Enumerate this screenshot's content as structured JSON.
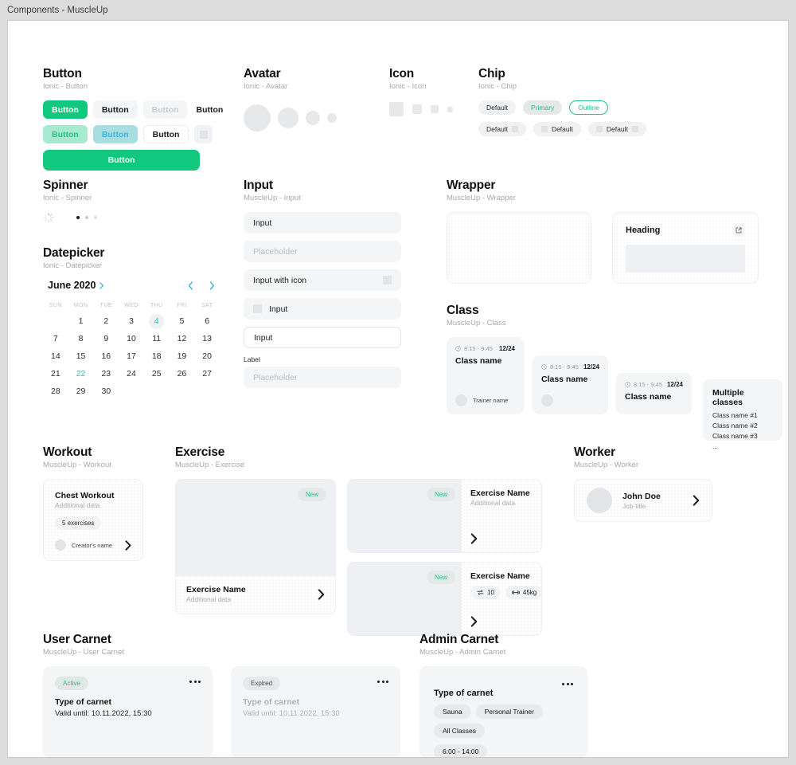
{
  "window": {
    "title": "Components - MuscleUp"
  },
  "colors": {
    "primary_green": "#10c97e",
    "teal_accent": "#24c28a",
    "blue_accent": "#3fb6d8",
    "surface": "#f4f5f7",
    "muted_text": "#a6a8ab"
  },
  "sections": {
    "button": {
      "title": "Button",
      "subtitle": "Ionic - Button"
    },
    "spinner": {
      "title": "Spinner",
      "subtitle": "Ionic - Spinner"
    },
    "datepicker": {
      "title": "Datepicker",
      "subtitle": "Ionic - Datepicker"
    },
    "avatar": {
      "title": "Avatar",
      "subtitle": "Ionic - Avatar"
    },
    "icon": {
      "title": "Icon",
      "subtitle": "Ionic - Icon"
    },
    "chip": {
      "title": "Chip",
      "subtitle": "Ionic - Chip"
    },
    "input": {
      "title": "Input",
      "subtitle": "MuscleUp - Input"
    },
    "wrapper": {
      "title": "Wrapper",
      "subtitle": "MuscleUp - Wrapper"
    },
    "class": {
      "title": "Class",
      "subtitle": "MuscleUp - Class"
    },
    "workout": {
      "title": "Workout",
      "subtitle": "MuscleUp - Workout"
    },
    "exercise": {
      "title": "Exercise",
      "subtitle": "MuscleUp - Exercise"
    },
    "worker": {
      "title": "Worker",
      "subtitle": "MuscleUp - Worker"
    },
    "user_carnet": {
      "title": "User Carnet",
      "subtitle": "MuscleUp - User Carnet"
    },
    "admin_carnet": {
      "title": "Admin Carnet",
      "subtitle": "MuscleUp - Admin Carnet"
    }
  },
  "buttons": {
    "row1": [
      {
        "label": "Button",
        "variant": "solid"
      },
      {
        "label": "Button",
        "variant": "light"
      },
      {
        "label": "Button",
        "variant": "disabled"
      },
      {
        "label": "Button",
        "variant": "plain"
      }
    ],
    "row2": [
      {
        "label": "Button",
        "variant": "teal-soft"
      },
      {
        "label": "Button",
        "variant": "teal-soft2"
      },
      {
        "label": "Button",
        "variant": "outline"
      },
      {
        "label": "",
        "variant": "icon-only"
      }
    ],
    "full": {
      "label": "Button",
      "variant": "solid-full"
    }
  },
  "spinner": {
    "dots": [
      {
        "color": "#1b1b1b"
      },
      {
        "color": "#c7cace"
      },
      {
        "color": "#dde0e3"
      }
    ]
  },
  "datepicker": {
    "month_label": "June 2020",
    "dow": [
      "SUN",
      "MON",
      "TUE",
      "WED",
      "THU",
      "FRI",
      "SAT"
    ],
    "leading_blanks": 1,
    "days": [
      1,
      2,
      3,
      4,
      5,
      6,
      7,
      8,
      9,
      10,
      11,
      12,
      13,
      14,
      15,
      16,
      17,
      18,
      19,
      20,
      21,
      22,
      23,
      24,
      25,
      26,
      27,
      28,
      29,
      30
    ],
    "selected_day": 4,
    "highlighted_day": 22
  },
  "avatar": {
    "sizes": [
      34,
      26,
      18,
      12
    ]
  },
  "icon": {
    "sizes": [
      18,
      12,
      10,
      7
    ]
  },
  "chips": {
    "row1": [
      {
        "label": "Default",
        "variant": "default"
      },
      {
        "label": "Primary",
        "variant": "primary"
      },
      {
        "label": "Outline",
        "variant": "outline"
      }
    ],
    "row2": [
      {
        "label": "Default",
        "icon": "trailing"
      },
      {
        "label": "Default",
        "icon": "leading"
      },
      {
        "label": "Default",
        "icon": "both"
      }
    ]
  },
  "inputs": [
    {
      "value": "Input",
      "style": "filled",
      "icon": "none"
    },
    {
      "value": "Placeholder",
      "style": "filled-ph",
      "icon": "none"
    },
    {
      "value": "Input with icon",
      "style": "filled",
      "icon": "trailing"
    },
    {
      "value": "Input",
      "style": "filled",
      "icon": "leading"
    },
    {
      "value": "Input",
      "style": "bordered",
      "icon": "none"
    }
  ],
  "input_labeled": {
    "label": "Label",
    "placeholder": "Placeholder"
  },
  "wrapper": {
    "heading": "Heading",
    "action_icon": "external-link-icon"
  },
  "class_cards": [
    {
      "time": "8:15 - 9:45",
      "count": "12/24",
      "name": "Class name",
      "trainer": "Trainer name",
      "has_trainer_name": true
    },
    {
      "time": "8:15 - 9:45",
      "count": "12/24",
      "name": "Class name",
      "trainer": "",
      "has_trainer_name": false
    },
    {
      "time": "8:15 - 9:45",
      "count": "12/24",
      "name": "Class name",
      "trainer": "",
      "has_trainer_name": false
    }
  ],
  "class_multi": {
    "title": "Multiple classes",
    "items": [
      "Class name #1",
      "Class name #2",
      "Class name #3",
      "..."
    ]
  },
  "workout_card": {
    "title": "Chest Workout",
    "subtitle": "Additional data",
    "pill": "5 exercises",
    "creator": "Creator's name"
  },
  "exercise_big": {
    "badge": "New",
    "name": "Exercise Name",
    "subtitle": "Additional data"
  },
  "exercise_wide": [
    {
      "badge": "New",
      "name": "Exercise Name",
      "subtitle": "Additional data",
      "stats": []
    },
    {
      "badge": "New",
      "name": "Exercise Name",
      "subtitle": "",
      "stats": [
        {
          "icon": "repeat-icon",
          "value": "10"
        },
        {
          "icon": "dumbbell-icon",
          "value": "45kg"
        }
      ]
    }
  ],
  "worker_card": {
    "name": "John Doe",
    "job": "Job title"
  },
  "user_carnets": [
    {
      "badge": "Active",
      "title": "Type of carnet",
      "valid": "Valid until: 10.11.2022, 15:30",
      "state": "active"
    },
    {
      "badge": "Expired",
      "title": "Type of carnet",
      "valid": "Valid until: 10.11.2022, 15:30",
      "state": "expired"
    }
  ],
  "admin_carnet": {
    "title": "Type of carnet",
    "tags": [
      "Sauna",
      "Personal Trainer",
      "All Classes"
    ],
    "hours": "6:00 - 14:00"
  }
}
